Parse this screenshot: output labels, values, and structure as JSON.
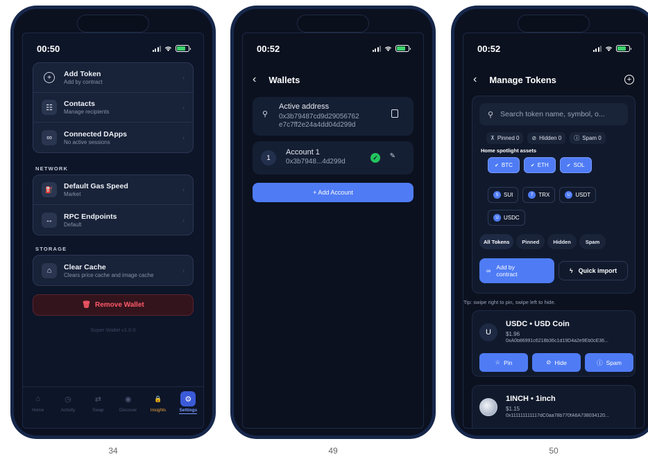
{
  "phone1": {
    "caption": "34",
    "time": "00:50",
    "items_top": [
      {
        "icon": "+",
        "title": "Add Token",
        "subtitle": "Add by contract"
      },
      {
        "icon": "☷",
        "title": "Contacts",
        "subtitle": "Manage recipients"
      },
      {
        "icon": "∞",
        "title": "Connected DApps",
        "subtitle": "No active sessions"
      }
    ],
    "network_label": "NETWORK",
    "network_items": [
      {
        "icon": "⛽",
        "title": "Default Gas Speed",
        "subtitle": "Market"
      },
      {
        "icon": "↔",
        "title": "RPC Endpoints",
        "subtitle": "Default"
      }
    ],
    "storage_label": "STORAGE",
    "storage_items": [
      {
        "icon": "⌂",
        "title": "Clear Cache",
        "subtitle": "Clears price cache and image cache"
      }
    ],
    "remove_wallet": "Remove Wallet",
    "version": "Super Wallet v1.0.0",
    "tabs": [
      {
        "label": "Home",
        "icon": "⌂"
      },
      {
        "label": "Activity",
        "icon": "◷"
      },
      {
        "label": "Swap",
        "icon": "⇄"
      },
      {
        "label": "Discover",
        "icon": "◉"
      },
      {
        "label": "Insights",
        "icon": "🔒"
      },
      {
        "label": "Settings",
        "icon": "⚙"
      }
    ]
  },
  "phone2": {
    "caption": "49",
    "time": "00:52",
    "title": "Wallets",
    "active_label": "Active address",
    "active_address_1": "0x3b79487cd9d29056762",
    "active_address_2": "e7c7ff2e24a4dd04d299d",
    "account_index": "1",
    "account_name": "Account 1",
    "account_address": "0x3b7948...4d299d",
    "add_account": "+  Add Account"
  },
  "phone3": {
    "caption": "50",
    "time": "00:52",
    "title": "Manage Tokens",
    "search_placeholder": "Search token name, symbol, o...",
    "counts": {
      "pinned": "Pinned 0",
      "hidden": "Hidden 0",
      "spam": "Spam 0"
    },
    "spotlight_label": "Home spotlight assets",
    "spotlight_selected": [
      "BTC",
      "ETH",
      "SOL"
    ],
    "spotlight_unselected": [
      {
        "letter": "S",
        "symbol": "SUI"
      },
      {
        "letter": "T",
        "symbol": "TRX"
      },
      {
        "letter": "U",
        "symbol": "USDT"
      },
      {
        "letter": "U",
        "symbol": "USDC"
      }
    ],
    "filters": [
      "All Tokens",
      "Pinned",
      "Hidden",
      "Spam"
    ],
    "add_by_contract": "Add by contract",
    "quick_import": "Quick import",
    "tip": "Tip: swipe right to pin, swipe left to hide.",
    "tokens": [
      {
        "avatar": "U",
        "name": "USDC • USD Coin",
        "price": "$1.96",
        "address": "0xA0b86991c6218b36c1d19D4a2e9Eb0cE36..."
      },
      {
        "avatar": "",
        "name": "1INCH • 1inch",
        "price": "$1.15",
        "address": "0x111111111117dC0aa78b770fA6A738034120..."
      }
    ],
    "actions": {
      "pin": "Pin",
      "hide": "Hide",
      "spam": "Spam"
    }
  },
  "colors": {
    "accent": "#4f7cf5",
    "danger": "#ff5a6a",
    "success": "#22c55e",
    "insights": "#f0a63a"
  }
}
